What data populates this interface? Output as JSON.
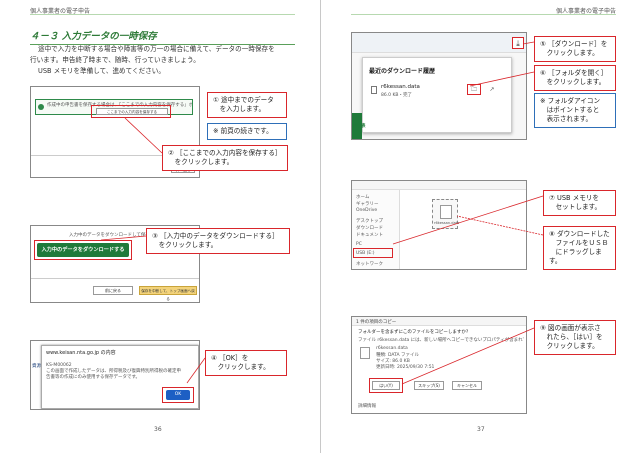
{
  "header": {
    "left_text": "個人事業者の電子申告",
    "right_text": "個人事業者の電子申告"
  },
  "left": {
    "section_title": "４－３ 入力データの一時保存",
    "intro": [
      "途中で入力を中断する場合や障害等の万一の場合に備えて、データの一時保存を",
      "行います。申告終了時まで、随時、行っていきましょう。",
      "USB メモリを準備して、進めてください。"
    ],
    "shot1": {
      "save_button": "ここまでの入力内容を保存する",
      "info_text": "作成中の申告書を保存する場合は、「ここまでの入力内容を保存する」ボタンをクリックしてください。",
      "back_button": "次へ進む"
    },
    "shot2": {
      "download_button": "入力中のデータをダウンロードする",
      "sub_text": "入力中のデータをダウンロードして保存してください",
      "back_button": "前に戻る",
      "next_button": "保存を中断して、トップ画面へ戻る"
    },
    "shot3": {
      "dialog_title": "www.keisan.nta.go.jp の内容",
      "dialog_code": "KS-M00062",
      "dialog_text": "この画面で作成したデータは、所得税及び復興特別所得税の確定申告書等の作成にのみ使用する保存データです。",
      "ok_button": "OK",
      "side_text": "資源"
    },
    "callouts": {
      "c1": [
        "① 途中までのデータ",
        "　を入力します。"
      ],
      "c2": [
        "※ 前頁の続きです。"
      ],
      "c3": [
        "② ［ここまでの入力内容を保存する］",
        "　をクリックします。"
      ],
      "c4": [
        "③ ［入力中のデータをダウンロードする］",
        "　をクリックします。"
      ],
      "c5": [
        "④ ［OK］を",
        "　クリックします。"
      ]
    },
    "page_number": "36"
  },
  "right": {
    "shot1": {
      "panel_title": "最近のダウンロード履歴",
      "file_name": "r6kessan.data",
      "file_meta": "86.0 KB・完了",
      "side_label": "申中表"
    },
    "shot2": {
      "file_label": "r6kessan.data",
      "sidebar_items": [
        "ホーム",
        "ギャラリー",
        "OneDrive",
        "デスクトップ",
        "ダウンロード",
        "ドキュメント",
        "PC",
        "USB (E:)",
        "ネットワーク"
      ]
    },
    "shot3": {
      "title": "1 件の項目のコピー",
      "message": "フォルダーを含まずにこのファイルをコピーしますか?",
      "detail": "ファイル r6kessan.data には、新しい場所へコピーできないプロパティが含まれています。",
      "file_name": "r6kessan.data",
      "file_type": "種類: DATA ファイル",
      "file_size": "サイズ: 86.0 KB",
      "file_date": "更新日時: 2025/09/30 7:51",
      "yes_button": "はい(Y)",
      "skip_button": "スキップ(S)",
      "cancel_button": "キャンセル",
      "details_label": "詳細情報"
    },
    "callouts": {
      "c5": [
        "⑤ ［ダウンロード］を",
        "　クリックします。"
      ],
      "c6": [
        "⑥ ［フォルダを開く］",
        "　をクリックします。"
      ],
      "c7": [
        "※ フォルダアイコン",
        "　はポイントすると",
        "　表示されます。"
      ],
      "c8": [
        "⑦ USB メモリを",
        "　セットします。"
      ],
      "c9": [
        "⑧ ダウンロードした",
        "　ファイルをＵＳＢ",
        "　にドラッグします。"
      ],
      "c10": [
        "⑨ 図の画面が表示さ",
        "　れたら、［はい］を",
        "　クリックします。"
      ]
    },
    "page_number": "37"
  },
  "colors": {
    "accent_green": "#2d7a37",
    "callout_red": "#d9262b",
    "callout_blue": "#2e6fb8",
    "button_green": "#1f7a3a"
  }
}
